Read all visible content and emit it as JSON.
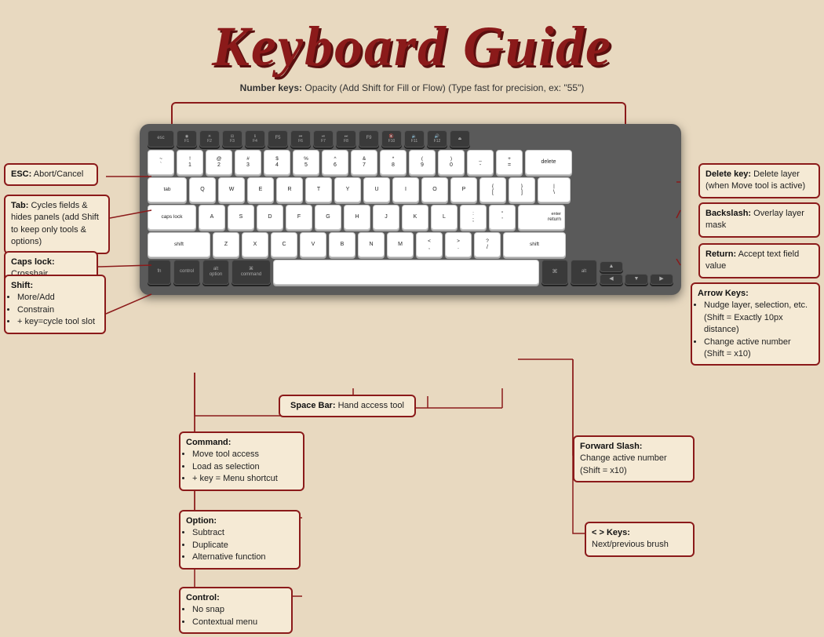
{
  "title": "Keyboard Guide",
  "subtitle": {
    "label": "Number keys:",
    "text": " Opacity (Add Shift for Fill or Flow) (Type fast for precision, ex: \"55\")"
  },
  "annotations": {
    "left": {
      "esc": {
        "label": "ESC:",
        "text": "Abort/Cancel"
      },
      "tab": {
        "label": "Tab:",
        "text": "Cycles fields & hides panels (add Shift to keep only tools & options)"
      },
      "caps": {
        "label": "Caps lock:",
        "text": "Crosshair"
      },
      "shift": {
        "label": "Shift:",
        "items": [
          "More/Add",
          "Constrain",
          "+ key=cycle tool slot"
        ]
      }
    },
    "right": {
      "delete": {
        "label": "Delete key:",
        "text": "Delete layer (when Move tool is active)"
      },
      "backslash": {
        "label": "Backslash:",
        "text": "Overlay layer mask"
      },
      "return": {
        "label": "Return:",
        "text": "Accept text field value"
      },
      "arrow": {
        "label": "Arrow Keys:",
        "items": [
          "Nudge layer, selection, etc. (Shift = Exactly 10px distance)",
          "Change active number (Shift = x10)"
        ]
      }
    },
    "bottom": {
      "command": {
        "label": "Command:",
        "items": [
          "Move tool access",
          "Load as selection",
          "+ key = Menu shortcut"
        ]
      },
      "option": {
        "label": "Option:",
        "items": [
          "Subtract",
          "Duplicate",
          "Alternative function"
        ]
      },
      "control": {
        "label": "Control:",
        "items": [
          "No snap",
          "Contextual menu"
        ]
      },
      "spacebar": {
        "label": "Space Bar:",
        "text": "Hand access tool"
      },
      "fwdslash": {
        "label": "Forward Slash:",
        "text": "Change active number (Shift = x10)"
      },
      "ltgt": {
        "label": "< > Keys:",
        "text": "Next/previous brush"
      }
    }
  }
}
